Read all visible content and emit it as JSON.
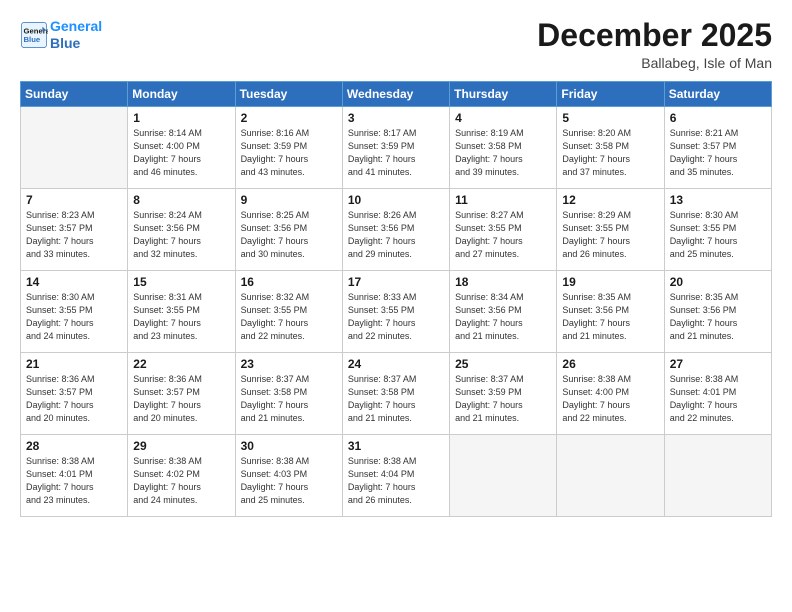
{
  "header": {
    "logo_line1": "General",
    "logo_line2": "Blue",
    "month": "December 2025",
    "location": "Ballabeg, Isle of Man"
  },
  "weekdays": [
    "Sunday",
    "Monday",
    "Tuesday",
    "Wednesday",
    "Thursday",
    "Friday",
    "Saturday"
  ],
  "weeks": [
    [
      {
        "day": "",
        "info": ""
      },
      {
        "day": "1",
        "info": "Sunrise: 8:14 AM\nSunset: 4:00 PM\nDaylight: 7 hours\nand 46 minutes."
      },
      {
        "day": "2",
        "info": "Sunrise: 8:16 AM\nSunset: 3:59 PM\nDaylight: 7 hours\nand 43 minutes."
      },
      {
        "day": "3",
        "info": "Sunrise: 8:17 AM\nSunset: 3:59 PM\nDaylight: 7 hours\nand 41 minutes."
      },
      {
        "day": "4",
        "info": "Sunrise: 8:19 AM\nSunset: 3:58 PM\nDaylight: 7 hours\nand 39 minutes."
      },
      {
        "day": "5",
        "info": "Sunrise: 8:20 AM\nSunset: 3:58 PM\nDaylight: 7 hours\nand 37 minutes."
      },
      {
        "day": "6",
        "info": "Sunrise: 8:21 AM\nSunset: 3:57 PM\nDaylight: 7 hours\nand 35 minutes."
      }
    ],
    [
      {
        "day": "7",
        "info": "Sunrise: 8:23 AM\nSunset: 3:57 PM\nDaylight: 7 hours\nand 33 minutes."
      },
      {
        "day": "8",
        "info": "Sunrise: 8:24 AM\nSunset: 3:56 PM\nDaylight: 7 hours\nand 32 minutes."
      },
      {
        "day": "9",
        "info": "Sunrise: 8:25 AM\nSunset: 3:56 PM\nDaylight: 7 hours\nand 30 minutes."
      },
      {
        "day": "10",
        "info": "Sunrise: 8:26 AM\nSunset: 3:56 PM\nDaylight: 7 hours\nand 29 minutes."
      },
      {
        "day": "11",
        "info": "Sunrise: 8:27 AM\nSunset: 3:55 PM\nDaylight: 7 hours\nand 27 minutes."
      },
      {
        "day": "12",
        "info": "Sunrise: 8:29 AM\nSunset: 3:55 PM\nDaylight: 7 hours\nand 26 minutes."
      },
      {
        "day": "13",
        "info": "Sunrise: 8:30 AM\nSunset: 3:55 PM\nDaylight: 7 hours\nand 25 minutes."
      }
    ],
    [
      {
        "day": "14",
        "info": "Sunrise: 8:30 AM\nSunset: 3:55 PM\nDaylight: 7 hours\nand 24 minutes."
      },
      {
        "day": "15",
        "info": "Sunrise: 8:31 AM\nSunset: 3:55 PM\nDaylight: 7 hours\nand 23 minutes."
      },
      {
        "day": "16",
        "info": "Sunrise: 8:32 AM\nSunset: 3:55 PM\nDaylight: 7 hours\nand 22 minutes."
      },
      {
        "day": "17",
        "info": "Sunrise: 8:33 AM\nSunset: 3:55 PM\nDaylight: 7 hours\nand 22 minutes."
      },
      {
        "day": "18",
        "info": "Sunrise: 8:34 AM\nSunset: 3:56 PM\nDaylight: 7 hours\nand 21 minutes."
      },
      {
        "day": "19",
        "info": "Sunrise: 8:35 AM\nSunset: 3:56 PM\nDaylight: 7 hours\nand 21 minutes."
      },
      {
        "day": "20",
        "info": "Sunrise: 8:35 AM\nSunset: 3:56 PM\nDaylight: 7 hours\nand 21 minutes."
      }
    ],
    [
      {
        "day": "21",
        "info": "Sunrise: 8:36 AM\nSunset: 3:57 PM\nDaylight: 7 hours\nand 20 minutes."
      },
      {
        "day": "22",
        "info": "Sunrise: 8:36 AM\nSunset: 3:57 PM\nDaylight: 7 hours\nand 20 minutes."
      },
      {
        "day": "23",
        "info": "Sunrise: 8:37 AM\nSunset: 3:58 PM\nDaylight: 7 hours\nand 21 minutes."
      },
      {
        "day": "24",
        "info": "Sunrise: 8:37 AM\nSunset: 3:58 PM\nDaylight: 7 hours\nand 21 minutes."
      },
      {
        "day": "25",
        "info": "Sunrise: 8:37 AM\nSunset: 3:59 PM\nDaylight: 7 hours\nand 21 minutes."
      },
      {
        "day": "26",
        "info": "Sunrise: 8:38 AM\nSunset: 4:00 PM\nDaylight: 7 hours\nand 22 minutes."
      },
      {
        "day": "27",
        "info": "Sunrise: 8:38 AM\nSunset: 4:01 PM\nDaylight: 7 hours\nand 22 minutes."
      }
    ],
    [
      {
        "day": "28",
        "info": "Sunrise: 8:38 AM\nSunset: 4:01 PM\nDaylight: 7 hours\nand 23 minutes."
      },
      {
        "day": "29",
        "info": "Sunrise: 8:38 AM\nSunset: 4:02 PM\nDaylight: 7 hours\nand 24 minutes."
      },
      {
        "day": "30",
        "info": "Sunrise: 8:38 AM\nSunset: 4:03 PM\nDaylight: 7 hours\nand 25 minutes."
      },
      {
        "day": "31",
        "info": "Sunrise: 8:38 AM\nSunset: 4:04 PM\nDaylight: 7 hours\nand 26 minutes."
      },
      {
        "day": "",
        "info": ""
      },
      {
        "day": "",
        "info": ""
      },
      {
        "day": "",
        "info": ""
      }
    ]
  ]
}
